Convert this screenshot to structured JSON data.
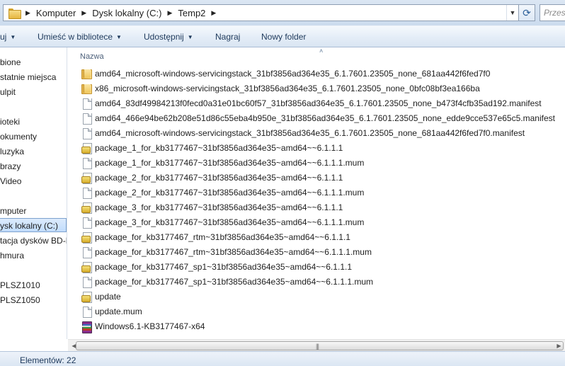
{
  "address_bar": {
    "crumbs": [
      "Komputer",
      "Dysk lokalny (C:)",
      "Temp2"
    ],
    "search_placeholder": "Przes"
  },
  "toolbar": {
    "organize_fragment": "uj",
    "library_label": "Umieść w bibliotece",
    "share_label": "Udostępnij",
    "burn_label": "Nagraj",
    "new_folder_label": "Nowy folder"
  },
  "nav": {
    "items": [
      "bione",
      "statnie miejsca",
      "ulpit",
      "ioteki",
      "okumenty",
      "luzyka",
      "brazy",
      "Video",
      "mputer",
      "ysk lokalny (C:)",
      "tacja dysków BD-R",
      "hmura",
      "PLSZ1010",
      "PLSZ1050"
    ],
    "selected_index": 9
  },
  "file_list": {
    "column_name": "Nazwa",
    "files": [
      {
        "name": "amd64_microsoft-windows-servicingstack_31bf3856ad364e35_6.1.7601.23505_none_681aa442f6fed7f0",
        "icon": "folder-icon"
      },
      {
        "name": "x86_microsoft-windows-servicingstack_31bf3856ad364e35_6.1.7601.23505_none_0bfc08bf3ea166ba",
        "icon": "folder-icon"
      },
      {
        "name": "amd64_83df49984213f0fecd0a31e01bc60f57_31bf3856ad364e35_6.1.7601.23505_none_b473f4cfb35ad192.manifest",
        "icon": "file-icon"
      },
      {
        "name": "amd64_466e94be62b208e51d86c55eba4b950e_31bf3856ad364e35_6.1.7601.23505_none_edde9cce537e65c5.manifest",
        "icon": "file-icon"
      },
      {
        "name": "amd64_microsoft-windows-servicingstack_31bf3856ad364e35_6.1.7601.23505_none_681aa442f6fed7f0.manifest",
        "icon": "file-icon"
      },
      {
        "name": "package_1_for_kb3177467~31bf3856ad364e35~amd64~~6.1.1.1",
        "icon": "catalog-icon"
      },
      {
        "name": "package_1_for_kb3177467~31bf3856ad364e35~amd64~~6.1.1.1.mum",
        "icon": "file-icon"
      },
      {
        "name": "package_2_for_kb3177467~31bf3856ad364e35~amd64~~6.1.1.1",
        "icon": "catalog-icon"
      },
      {
        "name": "package_2_for_kb3177467~31bf3856ad364e35~amd64~~6.1.1.1.mum",
        "icon": "file-icon"
      },
      {
        "name": "package_3_for_kb3177467~31bf3856ad364e35~amd64~~6.1.1.1",
        "icon": "catalog-icon"
      },
      {
        "name": "package_3_for_kb3177467~31bf3856ad364e35~amd64~~6.1.1.1.mum",
        "icon": "file-icon"
      },
      {
        "name": "package_for_kb3177467_rtm~31bf3856ad364e35~amd64~~6.1.1.1",
        "icon": "catalog-icon"
      },
      {
        "name": "package_for_kb3177467_rtm~31bf3856ad364e35~amd64~~6.1.1.1.mum",
        "icon": "file-icon"
      },
      {
        "name": "package_for_kb3177467_sp1~31bf3856ad364e35~amd64~~6.1.1.1",
        "icon": "catalog-icon"
      },
      {
        "name": "package_for_kb3177467_sp1~31bf3856ad364e35~amd64~~6.1.1.1.mum",
        "icon": "file-icon"
      },
      {
        "name": "update",
        "icon": "catalog-icon"
      },
      {
        "name": "update.mum",
        "icon": "file-icon"
      },
      {
        "name": "Windows6.1-KB3177467-x64",
        "icon": "archive-icon"
      }
    ]
  },
  "status_bar": {
    "count_text": "Elementów: 22"
  }
}
